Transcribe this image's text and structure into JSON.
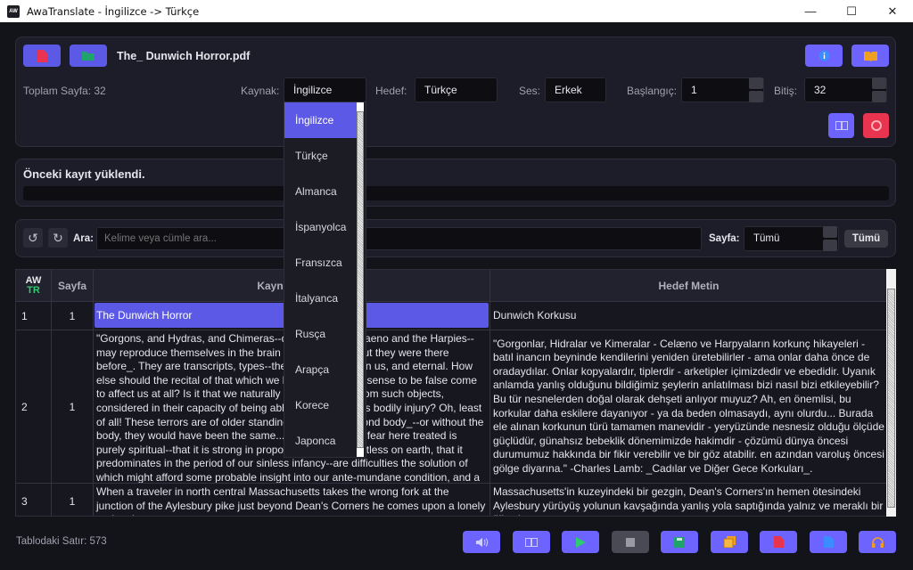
{
  "window": {
    "title": "AwaTranslate - İngilizce -> Türkçe",
    "icon_text": "AW"
  },
  "top": {
    "filename": "The_ Dunwich Horror.pdf",
    "total_pages_label": "Toplam Sayfa: 32",
    "source_label": "Kaynak:",
    "source_value": "İngilizce",
    "target_label": "Hedef:",
    "target_value": "Türkçe",
    "voice_label": "Ses:",
    "voice_value": "Erkek",
    "start_label": "Başlangıç:",
    "start_value": "1",
    "end_label": "Bitiş:",
    "end_value": "32"
  },
  "dropdown": {
    "items": [
      "İngilizce",
      "Türkçe",
      "Almanca",
      "İspanyolca",
      "Fransızca",
      "İtalyanca",
      "Rusça",
      "Arapça",
      "Korece",
      "Japonca"
    ],
    "selected": "İngilizce"
  },
  "status": {
    "message": "Önceki kayıt yüklendi.",
    "progress": 0
  },
  "search": {
    "label": "Ara:",
    "placeholder": "Kelime veya cümle ara...",
    "page_label": "Sayfa:",
    "page_value": "Tümü",
    "all_button": "Tümü"
  },
  "table": {
    "headers": {
      "aw": "AW",
      "tr": "TR",
      "page": "Sayfa",
      "source": "Kaynak Metin",
      "target": "Hedef Metin"
    },
    "rows": [
      {
        "num": "1",
        "page": "1",
        "source": "The Dunwich Horror",
        "target": "Dunwich Korkusu"
      },
      {
        "num": "2",
        "page": "1",
        "source": "\"Gorgons, and Hydras, and Chimeras--dire stories of Celaeno and the Harpies--may reproduce themselves in the brain of superstition--but they were there before_. They are transcripts, types--the archetypes are in us, and eternal. How else should the recital of that which we know in a waking sense to be false come to affect us at all? Is it that we naturally conceive terror from such objects, considered in their capacity of being able to inflict upon us bodily injury? Oh, least of all! These terrors are of older standing. They date beyond body_--or without the body, they would have been the same.... That the kind of fear here treated is purely spiritual--that it is strong in proportion as it is objectless on earth, that it predominates in the period of our sinless infancy--are difficulties the solution of which might afford some probable insight into our ante-mundane condition, and a peep at least into the shadowland of pre-...",
        "target": "\"Gorgonlar, Hidralar ve Kimeralar - Celæno ve Harpyaların korkunç hikayeleri - batıl inancın beyninde kendilerini yeniden üretebilirler - ama onlar daha önce de oradaydılar. Onlar kopyalardır, tiplerdir - arketipler içimizdedir ve ebedidir. Uyanık anlamda yanlış olduğunu bildiğimiz şeylerin anlatılması bizi nasıl bizi etkileyebilir? Bu tür nesnelerden doğal olarak dehşeti anlıyor muyuz? Ah, en önemlisi, bu korkular daha eskilere dayanıyor - ya da beden olmasaydı, aynı olurdu... Burada ele alınan korkunun türü tamamen manevidir - yeryüzünde nesnesiz olduğu ölçüde güçlüdür, günahsız bebeklik dönemimizde hakimdir - çözümü dünya öncesi durumumuz hakkında bir fikir verebilir ve bir göz atabilir. en azından varoluş öncesi gölge diyarına.\" -Charles Lamb: _Cadılar ve Diğer Gece Korkuları_."
      },
      {
        "num": "3",
        "page": "1",
        "source": "When a traveler in north central Massachusetts takes the wrong fork at the junction of the Aylesbury pike just beyond Dean's Corners he comes upon a lonely and curious ...",
        "target": "Massachusetts'in kuzeyindeki bir gezgin, Dean's Corners'ın hemen ötesindeki Aylesbury yürüyüş yolunun kavşağında yanlış yola saptığında yalnız ve meraklı bir ülkeyle ..."
      }
    ]
  },
  "footer": {
    "row_count": "Tablodaki Satır: 573"
  },
  "colors": {
    "accent": "#5b59e6",
    "danger": "#e8344f",
    "success": "#2ecc71"
  }
}
